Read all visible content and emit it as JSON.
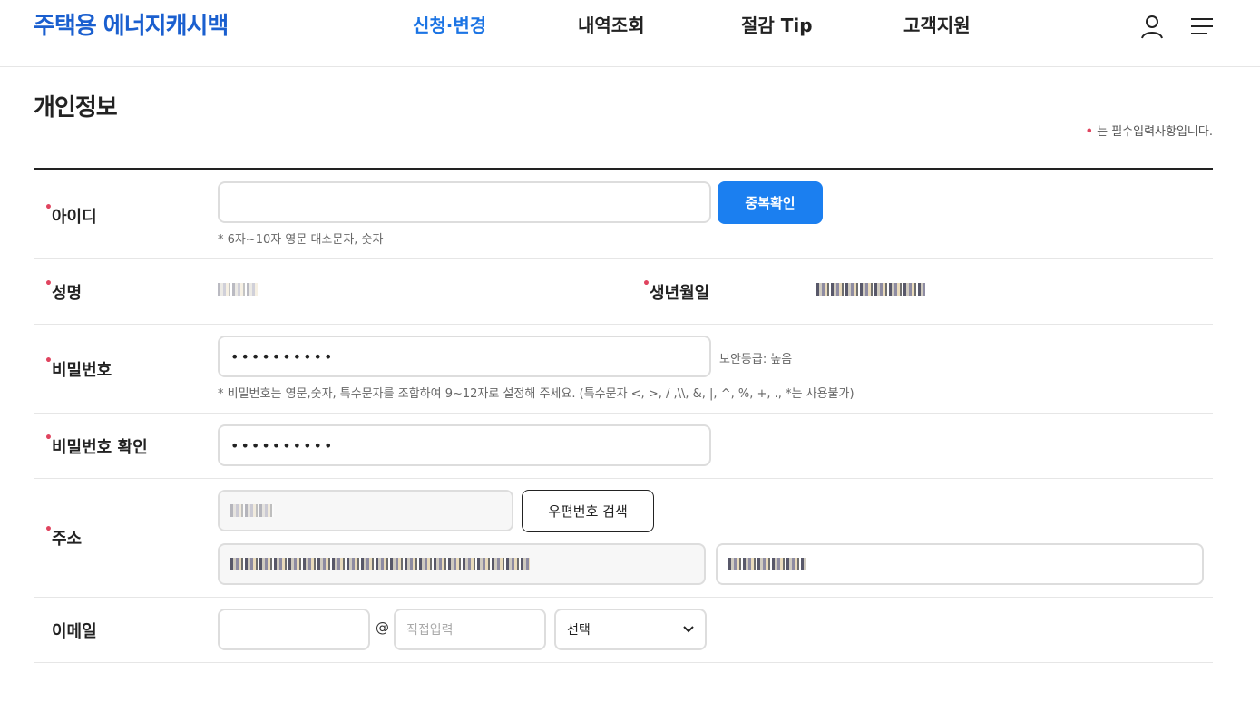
{
  "header": {
    "logo": "주택용 에너지캐시백",
    "nav": [
      "신청·변경",
      "내역조회",
      "절감 Tip",
      "고객지원"
    ],
    "active_nav": "신청·변경"
  },
  "page": {
    "title": "개인정보",
    "required_note": "는 필수입력사항입니다.",
    "required_mark": "•"
  },
  "fields": {
    "id": {
      "label": "아이디",
      "value": "",
      "button": "중복확인",
      "hint": "* 6자~10자 영문 대소문자, 숫자"
    },
    "name": {
      "label": "성명"
    },
    "birth": {
      "label": "생년월일"
    },
    "password": {
      "label": "비밀번호",
      "value": "••••••••••",
      "strength": "보안등급: 높음",
      "hint": "* 비밀번호는 영문,숫자, 특수문자를 조합하여 9~12자로 설정해 주세요. (특수문자 <, >, / ,\\\\, &, |, ^, %, +, ., *는 사용불가)"
    },
    "password_confirm": {
      "label": "비밀번호 확인",
      "value": "••••••••••"
    },
    "address": {
      "label": "주소",
      "button": "우편번호 검색"
    },
    "email": {
      "label": "이메일",
      "at": "@",
      "domain_placeholder": "직접입력",
      "select_value": "선택"
    }
  },
  "colors": {
    "brand": "#1a5fcf",
    "active_nav": "#1b74e4",
    "button_blue": "#1b7ff0",
    "required_dot": "#e0445f"
  },
  "icons": [
    "user-icon",
    "menu-icon",
    "chevron-down-icon"
  ]
}
